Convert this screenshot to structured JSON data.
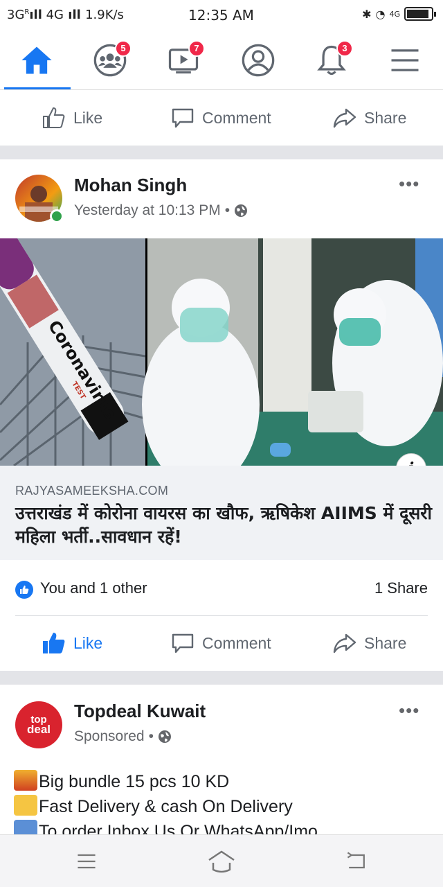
{
  "status_bar": {
    "network": "3G",
    "network_sup": "R",
    "network2": "4G",
    "speed": "1.9K/s",
    "time": "12:35 AM",
    "network3": "4G",
    "battery_level": 0.9
  },
  "nav": {
    "items": [
      {
        "name": "home",
        "badge": ""
      },
      {
        "name": "groups",
        "badge": "5"
      },
      {
        "name": "watch",
        "badge": "7"
      },
      {
        "name": "profile",
        "badge": ""
      },
      {
        "name": "notifications",
        "badge": "3"
      },
      {
        "name": "menu",
        "badge": ""
      }
    ],
    "active": "home",
    "accent": "#1877f2",
    "badge_color": "#f02849"
  },
  "actions": {
    "like": "Like",
    "comment": "Comment",
    "share": "Share"
  },
  "post": {
    "author": "Mohan Singh",
    "timestamp": "Yesterday at 10:13 PM",
    "separator": "•",
    "link": {
      "image_text": "Coronavirus",
      "image_subtext": "TEST",
      "domain": "RAJYASAMEEKSHA.COM",
      "title": "उत्तराखंड में कोरोना वायरस का खौफ, ऋषिकेश AIIMS में दूसरी महिला भर्ती..सावधान रहें!"
    },
    "reactions_label": "You and 1 other",
    "shares_label": "1 Share"
  },
  "sponsored_post": {
    "author": "Topdeal Kuwait",
    "label": "Sponsored",
    "separator": "•",
    "avatar_text_top": "top",
    "avatar_text_bottom": "deal",
    "lines": [
      "Big bundle 15 pcs 10 KD",
      "Fast Delivery & cash On Delivery",
      "To order Inbox Us Or WhatsApp/Imo"
    ]
  }
}
